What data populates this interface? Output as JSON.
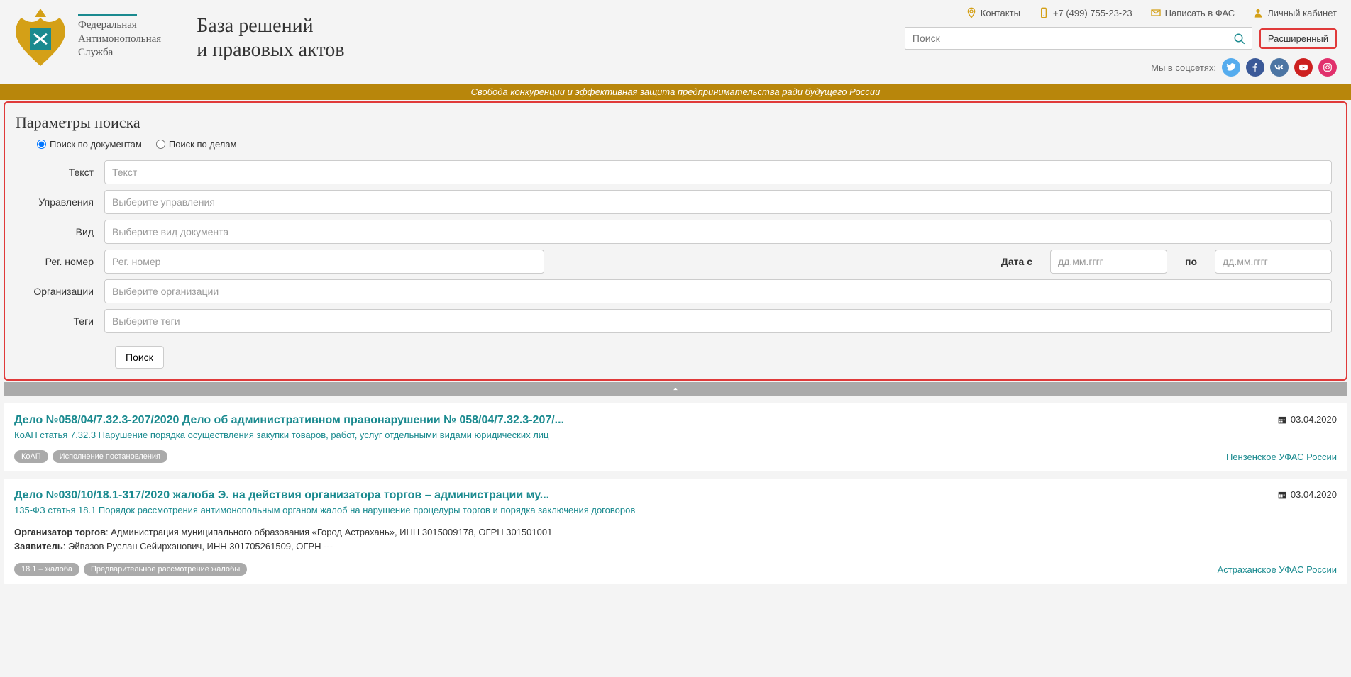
{
  "header": {
    "service_name_l1": "Федеральная",
    "service_name_l2": "Антимонопольная",
    "service_name_l3": "Служба",
    "title_l1": "База решений",
    "title_l2": "и правовых актов",
    "links": {
      "contacts": "Контакты",
      "phone": "+7 (499) 755-23-23",
      "write": "Написать в ФАС",
      "account": "Личный кабинет"
    },
    "search_placeholder": "Поиск",
    "advanced": "Расширенный",
    "social_label": "Мы в соцсетях:"
  },
  "motto": "Свобода конкуренции и эффективная защита предпринимательства ради будущего России",
  "panel": {
    "title": "Параметры поиска",
    "radio1": "Поиск по документам",
    "radio2": "Поиск по делам",
    "labels": {
      "text": "Текст",
      "dept": "Управления",
      "kind": "Вид",
      "reg": "Рег. номер",
      "date_from": "Дата с",
      "date_to": "по",
      "org": "Организации",
      "tags": "Теги"
    },
    "placeholders": {
      "text": "Текст",
      "dept": "Выберите управления",
      "kind": "Выберите вид документа",
      "reg": "Рег. номер",
      "date": "дд.мм.гггг",
      "org": "Выберите организации",
      "tags": "Выберите теги"
    },
    "search_btn": "Поиск"
  },
  "results": [
    {
      "title": "Дело №058/04/7.32.3-207/2020 Дело об административном правонарушении № 058/04/7.32.3-207/...",
      "date": "03.04.2020",
      "sub": "КоАП статья 7.32.3 Нарушение порядка осуществления закупки товаров, работ, услуг отдельными видами юридических лиц",
      "body_lines": [],
      "tags": [
        "КоАП",
        "Исполнение постановления"
      ],
      "ufas": "Пензенское УФАС России"
    },
    {
      "title": "Дело №030/10/18.1-317/2020 жалоба Э. на действия организатора торгов – администрации му...",
      "date": "03.04.2020",
      "sub": "135-ФЗ статья 18.1 Порядок рассмотрения антимонопольным органом жалоб на нарушение процедуры торгов и порядка заключения договоров",
      "body_lines": [
        {
          "label": "Организатор торгов",
          "text": ": Администрация муниципального образования «Город Астрахань», ИНН 3015009178, ОГРН 301501001"
        },
        {
          "label": "Заявитель",
          "text": ": Эйвазов Руслан Сейирханович, ИНН 301705261509, ОГРН ---"
        }
      ],
      "tags": [
        "18.1 – жалоба",
        "Предварительное рассмотрение жалобы"
      ],
      "ufas": "Астраханское УФАС России"
    }
  ]
}
